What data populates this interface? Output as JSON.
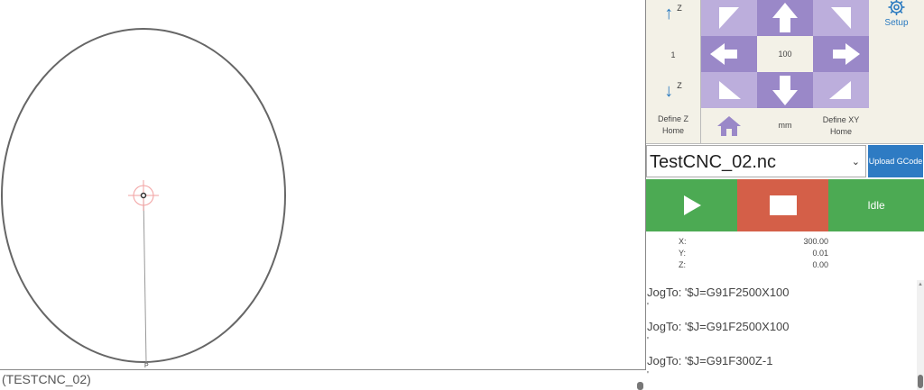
{
  "gcode": {
    "current_line": "(TESTCNC_02)"
  },
  "zcontrols": {
    "z_up_icon": "up-arrow",
    "z_up_label": "Z",
    "z_step": "1",
    "z_down_icon": "down-arrow",
    "z_down_label": "Z",
    "define_z_home": "Define Z Home"
  },
  "jog": {
    "step": "100",
    "units": "mm",
    "define_xy_home": "Define XY Home"
  },
  "setup": {
    "label": "Setup",
    "icon": "gear-icon"
  },
  "file": {
    "selected": "TestCNC_02.nc",
    "upload_label": "Upload GCode"
  },
  "status": {
    "state": "Idle"
  },
  "coords": [
    {
      "axis": "X:",
      "value": "300.00"
    },
    {
      "axis": "Y:",
      "value": "0.01"
    },
    {
      "axis": "Z:",
      "value": "0.00"
    }
  ],
  "console": [
    {
      "text": "JogTo: '$J=G91F2500X100",
      "tail": "'"
    },
    {
      "text": "JogTo: '$J=G91F2500X100",
      "tail": "'"
    },
    {
      "text": "JogTo: '$J=G91F300Z-1",
      "tail": "'"
    }
  ],
  "colors": {
    "jog_dark": "#9a88c8",
    "jog_light": "#bcaedc",
    "play": "#4caa53",
    "stop": "#d45f48",
    "accent": "#2e7bc3"
  }
}
